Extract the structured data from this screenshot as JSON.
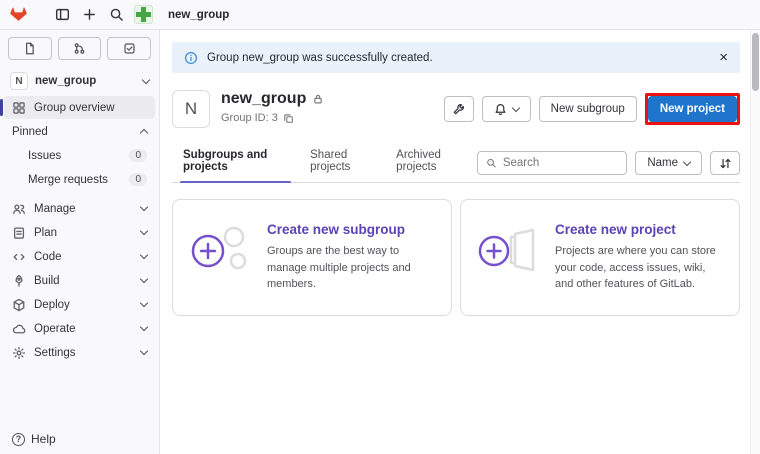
{
  "topbar": {
    "breadcrumb": "new_group"
  },
  "sidebar": {
    "group": {
      "initial": "N",
      "name": "new_group"
    },
    "items": [
      {
        "label": "Group overview"
      },
      {
        "label": "Pinned"
      },
      {
        "label": "Issues",
        "count": "0"
      },
      {
        "label": "Merge requests",
        "count": "0"
      },
      {
        "label": "Manage"
      },
      {
        "label": "Plan"
      },
      {
        "label": "Code"
      },
      {
        "label": "Build"
      },
      {
        "label": "Deploy"
      },
      {
        "label": "Operate"
      },
      {
        "label": "Settings"
      }
    ],
    "help_label": "Help"
  },
  "alert": {
    "message": "Group new_group was successfully created."
  },
  "header": {
    "avatar_initial": "N",
    "title": "new_group",
    "group_id": "Group ID: 3",
    "new_subgroup_label": "New subgroup",
    "new_project_label": "New project"
  },
  "tabs": [
    {
      "label": "Subgroups and projects"
    },
    {
      "label": "Shared projects"
    },
    {
      "label": "Archived projects"
    }
  ],
  "filters": {
    "search_placeholder": "Search",
    "sort_by": "Name"
  },
  "cards": [
    {
      "title": "Create new subgroup",
      "body": "Groups are the best way to manage multiple projects and members."
    },
    {
      "title": "Create new project",
      "body": "Projects are where you can store your code, access issues, wiki, and other features of GitLab."
    }
  ],
  "icons": {
    "help": "?",
    "close": "×"
  },
  "colors": {
    "primary": "#1f75cb",
    "link": "#5943b6",
    "annotation": "#ec1212",
    "alert_bg": "#e9f2fb",
    "active_indicator": "#41419f"
  }
}
